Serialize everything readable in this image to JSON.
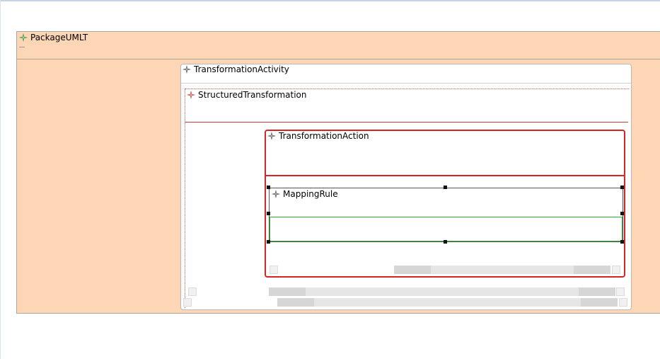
{
  "package": {
    "name": "PackageUMLT",
    "icon": "element-star-icon"
  },
  "activity": {
    "name": "TransformationActivity",
    "icon": "element-star-icon"
  },
  "structured": {
    "name": "StructuredTransformation",
    "icon": "element-star-icon"
  },
  "action": {
    "name": "TransformationAction",
    "icon": "element-star-icon"
  },
  "mapping_rule": {
    "name": "MappingRule",
    "icon": "element-star-icon",
    "selected": true
  },
  "colors": {
    "package_fill": "#fdd6b6",
    "action_border": "#d32626",
    "structured_border": "#d45a5a",
    "selection_green": "#2fb02f",
    "icon_green": "#3a8f3a",
    "icon_gray": "#555555",
    "icon_red": "#c04040"
  }
}
